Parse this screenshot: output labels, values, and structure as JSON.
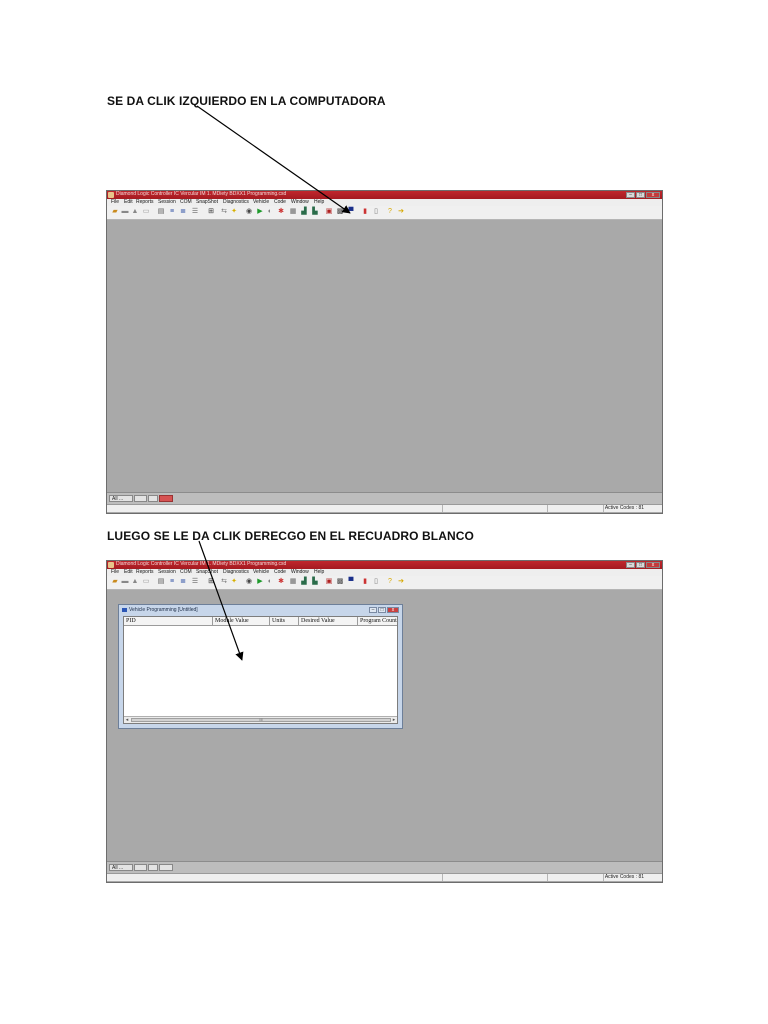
{
  "captions": {
    "first": "SE DA CLIK IZQUIERDO EN LA COMPUTADORA",
    "second": "LUEGO SE LE DA CLIK DERECGO EN EL RECUADRO BLANCO"
  },
  "app": {
    "title": "Diamond Logic Controller IC Vercular IM 1. MDiety BDXX1 Programming.csd",
    "menu": [
      "File",
      "Edit",
      "Reports",
      "Session",
      "COM",
      "SnapShot",
      "Diagnostics",
      "Vehicle",
      "Code",
      "Window",
      "Help"
    ],
    "window_buttons": {
      "minimize": "–",
      "maximize": "□",
      "close": "x"
    },
    "status_text": "Active Codes : 81",
    "task_label": "All ..."
  },
  "child_window": {
    "title": "Vehicle Programming [Untitled]",
    "columns": [
      "PID",
      "Module Value",
      "Units",
      "Desired Value",
      "Program Count"
    ],
    "scroll_mid": "III"
  },
  "colors": {
    "titlebar": "#b3222a",
    "workspace": "#a9a9a9",
    "child_frame": "#c7d6ea"
  }
}
